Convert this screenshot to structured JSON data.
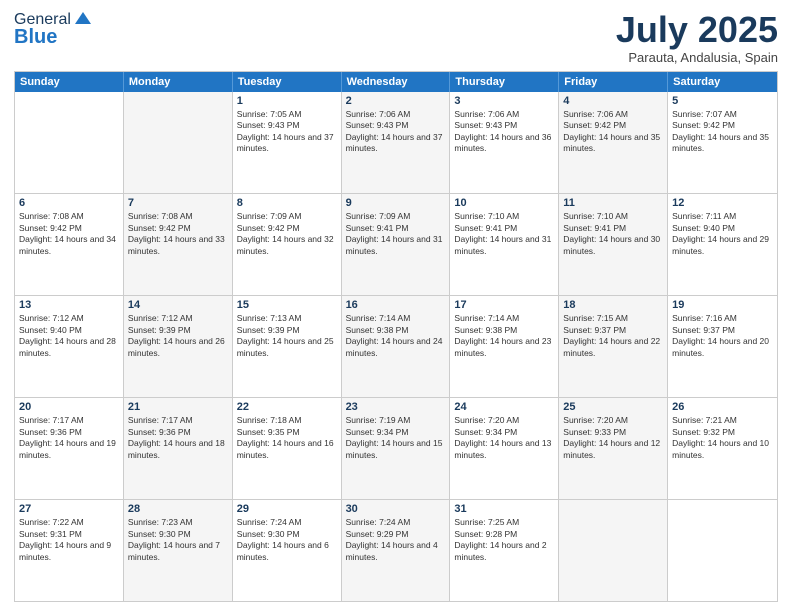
{
  "header": {
    "logo_general": "General",
    "logo_blue": "Blue",
    "month": "July 2025",
    "location": "Parauta, Andalusia, Spain"
  },
  "weekdays": [
    "Sunday",
    "Monday",
    "Tuesday",
    "Wednesday",
    "Thursday",
    "Friday",
    "Saturday"
  ],
  "rows": [
    [
      {
        "day": "",
        "sunrise": "",
        "sunset": "",
        "daylight": "",
        "shaded": false
      },
      {
        "day": "",
        "sunrise": "",
        "sunset": "",
        "daylight": "",
        "shaded": true
      },
      {
        "day": "1",
        "sunrise": "Sunrise: 7:05 AM",
        "sunset": "Sunset: 9:43 PM",
        "daylight": "Daylight: 14 hours and 37 minutes.",
        "shaded": false
      },
      {
        "day": "2",
        "sunrise": "Sunrise: 7:06 AM",
        "sunset": "Sunset: 9:43 PM",
        "daylight": "Daylight: 14 hours and 37 minutes.",
        "shaded": true
      },
      {
        "day": "3",
        "sunrise": "Sunrise: 7:06 AM",
        "sunset": "Sunset: 9:43 PM",
        "daylight": "Daylight: 14 hours and 36 minutes.",
        "shaded": false
      },
      {
        "day": "4",
        "sunrise": "Sunrise: 7:06 AM",
        "sunset": "Sunset: 9:42 PM",
        "daylight": "Daylight: 14 hours and 35 minutes.",
        "shaded": true
      },
      {
        "day": "5",
        "sunrise": "Sunrise: 7:07 AM",
        "sunset": "Sunset: 9:42 PM",
        "daylight": "Daylight: 14 hours and 35 minutes.",
        "shaded": false
      }
    ],
    [
      {
        "day": "6",
        "sunrise": "Sunrise: 7:08 AM",
        "sunset": "Sunset: 9:42 PM",
        "daylight": "Daylight: 14 hours and 34 minutes.",
        "shaded": false
      },
      {
        "day": "7",
        "sunrise": "Sunrise: 7:08 AM",
        "sunset": "Sunset: 9:42 PM",
        "daylight": "Daylight: 14 hours and 33 minutes.",
        "shaded": true
      },
      {
        "day": "8",
        "sunrise": "Sunrise: 7:09 AM",
        "sunset": "Sunset: 9:42 PM",
        "daylight": "Daylight: 14 hours and 32 minutes.",
        "shaded": false
      },
      {
        "day": "9",
        "sunrise": "Sunrise: 7:09 AM",
        "sunset": "Sunset: 9:41 PM",
        "daylight": "Daylight: 14 hours and 31 minutes.",
        "shaded": true
      },
      {
        "day": "10",
        "sunrise": "Sunrise: 7:10 AM",
        "sunset": "Sunset: 9:41 PM",
        "daylight": "Daylight: 14 hours and 31 minutes.",
        "shaded": false
      },
      {
        "day": "11",
        "sunrise": "Sunrise: 7:10 AM",
        "sunset": "Sunset: 9:41 PM",
        "daylight": "Daylight: 14 hours and 30 minutes.",
        "shaded": true
      },
      {
        "day": "12",
        "sunrise": "Sunrise: 7:11 AM",
        "sunset": "Sunset: 9:40 PM",
        "daylight": "Daylight: 14 hours and 29 minutes.",
        "shaded": false
      }
    ],
    [
      {
        "day": "13",
        "sunrise": "Sunrise: 7:12 AM",
        "sunset": "Sunset: 9:40 PM",
        "daylight": "Daylight: 14 hours and 28 minutes.",
        "shaded": false
      },
      {
        "day": "14",
        "sunrise": "Sunrise: 7:12 AM",
        "sunset": "Sunset: 9:39 PM",
        "daylight": "Daylight: 14 hours and 26 minutes.",
        "shaded": true
      },
      {
        "day": "15",
        "sunrise": "Sunrise: 7:13 AM",
        "sunset": "Sunset: 9:39 PM",
        "daylight": "Daylight: 14 hours and 25 minutes.",
        "shaded": false
      },
      {
        "day": "16",
        "sunrise": "Sunrise: 7:14 AM",
        "sunset": "Sunset: 9:38 PM",
        "daylight": "Daylight: 14 hours and 24 minutes.",
        "shaded": true
      },
      {
        "day": "17",
        "sunrise": "Sunrise: 7:14 AM",
        "sunset": "Sunset: 9:38 PM",
        "daylight": "Daylight: 14 hours and 23 minutes.",
        "shaded": false
      },
      {
        "day": "18",
        "sunrise": "Sunrise: 7:15 AM",
        "sunset": "Sunset: 9:37 PM",
        "daylight": "Daylight: 14 hours and 22 minutes.",
        "shaded": true
      },
      {
        "day": "19",
        "sunrise": "Sunrise: 7:16 AM",
        "sunset": "Sunset: 9:37 PM",
        "daylight": "Daylight: 14 hours and 20 minutes.",
        "shaded": false
      }
    ],
    [
      {
        "day": "20",
        "sunrise": "Sunrise: 7:17 AM",
        "sunset": "Sunset: 9:36 PM",
        "daylight": "Daylight: 14 hours and 19 minutes.",
        "shaded": false
      },
      {
        "day": "21",
        "sunrise": "Sunrise: 7:17 AM",
        "sunset": "Sunset: 9:36 PM",
        "daylight": "Daylight: 14 hours and 18 minutes.",
        "shaded": true
      },
      {
        "day": "22",
        "sunrise": "Sunrise: 7:18 AM",
        "sunset": "Sunset: 9:35 PM",
        "daylight": "Daylight: 14 hours and 16 minutes.",
        "shaded": false
      },
      {
        "day": "23",
        "sunrise": "Sunrise: 7:19 AM",
        "sunset": "Sunset: 9:34 PM",
        "daylight": "Daylight: 14 hours and 15 minutes.",
        "shaded": true
      },
      {
        "day": "24",
        "sunrise": "Sunrise: 7:20 AM",
        "sunset": "Sunset: 9:34 PM",
        "daylight": "Daylight: 14 hours and 13 minutes.",
        "shaded": false
      },
      {
        "day": "25",
        "sunrise": "Sunrise: 7:20 AM",
        "sunset": "Sunset: 9:33 PM",
        "daylight": "Daylight: 14 hours and 12 minutes.",
        "shaded": true
      },
      {
        "day": "26",
        "sunrise": "Sunrise: 7:21 AM",
        "sunset": "Sunset: 9:32 PM",
        "daylight": "Daylight: 14 hours and 10 minutes.",
        "shaded": false
      }
    ],
    [
      {
        "day": "27",
        "sunrise": "Sunrise: 7:22 AM",
        "sunset": "Sunset: 9:31 PM",
        "daylight": "Daylight: 14 hours and 9 minutes.",
        "shaded": false
      },
      {
        "day": "28",
        "sunrise": "Sunrise: 7:23 AM",
        "sunset": "Sunset: 9:30 PM",
        "daylight": "Daylight: 14 hours and 7 minutes.",
        "shaded": true
      },
      {
        "day": "29",
        "sunrise": "Sunrise: 7:24 AM",
        "sunset": "Sunset: 9:30 PM",
        "daylight": "Daylight: 14 hours and 6 minutes.",
        "shaded": false
      },
      {
        "day": "30",
        "sunrise": "Sunrise: 7:24 AM",
        "sunset": "Sunset: 9:29 PM",
        "daylight": "Daylight: 14 hours and 4 minutes.",
        "shaded": true
      },
      {
        "day": "31",
        "sunrise": "Sunrise: 7:25 AM",
        "sunset": "Sunset: 9:28 PM",
        "daylight": "Daylight: 14 hours and 2 minutes.",
        "shaded": false
      },
      {
        "day": "",
        "sunrise": "",
        "sunset": "",
        "daylight": "",
        "shaded": true
      },
      {
        "day": "",
        "sunrise": "",
        "sunset": "",
        "daylight": "",
        "shaded": false
      }
    ]
  ]
}
